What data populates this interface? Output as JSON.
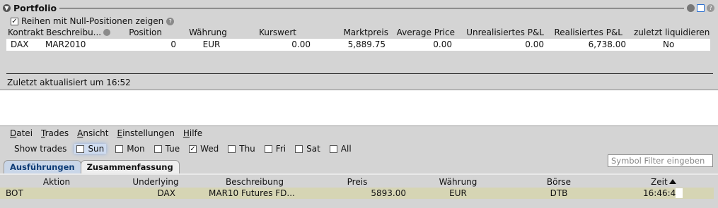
{
  "portfolio": {
    "title": "Portfolio",
    "null_positions_label": "Reihen mit Null-Positionen zeigen",
    "null_positions_checked": true,
    "columns": [
      "Kontrakt",
      "Beschreibu...",
      "Position",
      "Währung",
      "Kurswert",
      "Marktpreis",
      "Average Price",
      "Unrealisiertes P&L",
      "Realisiertes P&L",
      "zuletzt liquidieren"
    ],
    "rows": [
      [
        "DAX",
        "MAR2010",
        "0",
        "EUR",
        "0.00",
        "5,889.75",
        "0.00",
        "0.00",
        "6,738.00",
        "No"
      ]
    ],
    "updated": "Zuletzt aktualisiert um 16:52"
  },
  "menu": [
    {
      "u": "D",
      "rest": "atei"
    },
    {
      "u": "T",
      "rest": "rades"
    },
    {
      "u": "A",
      "rest": "nsicht"
    },
    {
      "u": "E",
      "rest": "instellungen"
    },
    {
      "u": "H",
      "rest": "ilfe"
    }
  ],
  "show_trades": {
    "label": "Show trades",
    "days": [
      {
        "label": "Sun",
        "checked": false
      },
      {
        "label": "Mon",
        "checked": false
      },
      {
        "label": "Tue",
        "checked": false
      },
      {
        "label": "Wed",
        "checked": true
      },
      {
        "label": "Thu",
        "checked": false
      },
      {
        "label": "Fri",
        "checked": false
      },
      {
        "label": "Sat",
        "checked": false
      },
      {
        "label": "All",
        "checked": false
      }
    ]
  },
  "symbol_filter": {
    "placeholder": "Symbol Filter eingeben"
  },
  "tabs": [
    "Ausführungen",
    "Zusammenfassung"
  ],
  "trades": {
    "columns": [
      "Aktion",
      "Underlying",
      "Beschreibung",
      "Preis",
      "Währung",
      "Börse",
      "Zeit"
    ],
    "rows": [
      [
        "BOT",
        "DAX",
        "MAR10 Futures FD...",
        "5893.00",
        "EUR",
        "DTB",
        "16:46:4"
      ]
    ]
  },
  "colors": {
    "panel": "#d4d4d4",
    "active_tab": "#c9d6e8",
    "trade_row": "#d6d5b4"
  }
}
